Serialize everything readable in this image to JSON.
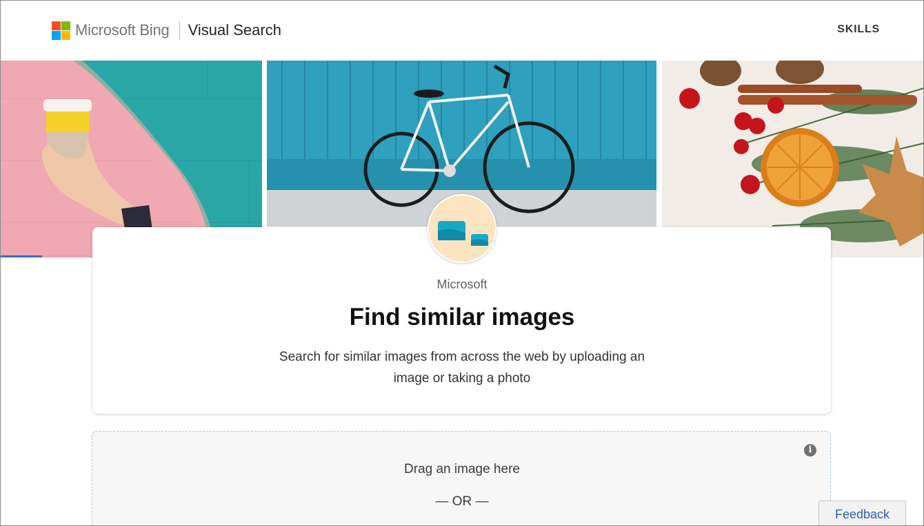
{
  "header": {
    "brand": "Microsoft Bing",
    "product": "Visual Search",
    "nav_skills": "SKILLS",
    "logo_colors": [
      "#f25022",
      "#7fba00",
      "#00a4ef",
      "#ffb900"
    ]
  },
  "hero": {
    "images": [
      "coffee-cup-on-wall-photo",
      "bicycle-photo",
      "holiday-spices-photo"
    ]
  },
  "card": {
    "publisher": "Microsoft",
    "title": "Find similar images",
    "description": "Search for similar images from across the web by uploading an image or taking a photo",
    "icon": "visual-search-skill-icon"
  },
  "dropzone": {
    "drag_text": "Drag an image here",
    "or_text": "— OR —",
    "info_icon": "info-icon"
  },
  "feedback": {
    "label": "Feedback"
  }
}
